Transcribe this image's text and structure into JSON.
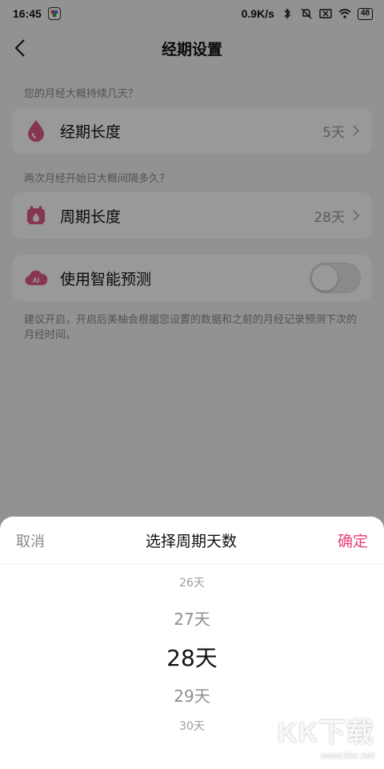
{
  "status_bar": {
    "time": "16:45",
    "network_speed": "0.9K/s",
    "battery": "48",
    "icons": [
      "app-chip-icon",
      "bluetooth-icon",
      "mute-icon",
      "sim-off-icon",
      "wifi-icon",
      "battery-icon"
    ]
  },
  "nav": {
    "title": "经期设置",
    "back_icon": "chevron-left-icon"
  },
  "period": {
    "hint": "您的月经大概持续几天？",
    "label": "经期长度",
    "value": "5天",
    "icon": "drop-icon"
  },
  "cycle": {
    "hint": "两次月经开始日大概间隔多久？",
    "label": "周期长度",
    "value": "28天",
    "icon": "calendar-icon"
  },
  "smart": {
    "label": "使用智能预测",
    "icon": "ai-cloud-icon",
    "toggle_on": false,
    "note": "建议开启，开启后美柚会根据您设置的数据和之前的月经记录预测下次的月经时间。"
  },
  "sheet": {
    "cancel": "取消",
    "title": "选择周期天数",
    "confirm": "确定",
    "options": [
      "26天",
      "27天",
      "28天",
      "29天",
      "30天"
    ],
    "selected": "28天"
  },
  "watermark": {
    "logo": "KK下载",
    "url": "www.kkx.net"
  },
  "colors": {
    "accent": "#e8407a",
    "icon_pink": "#e25a86"
  }
}
